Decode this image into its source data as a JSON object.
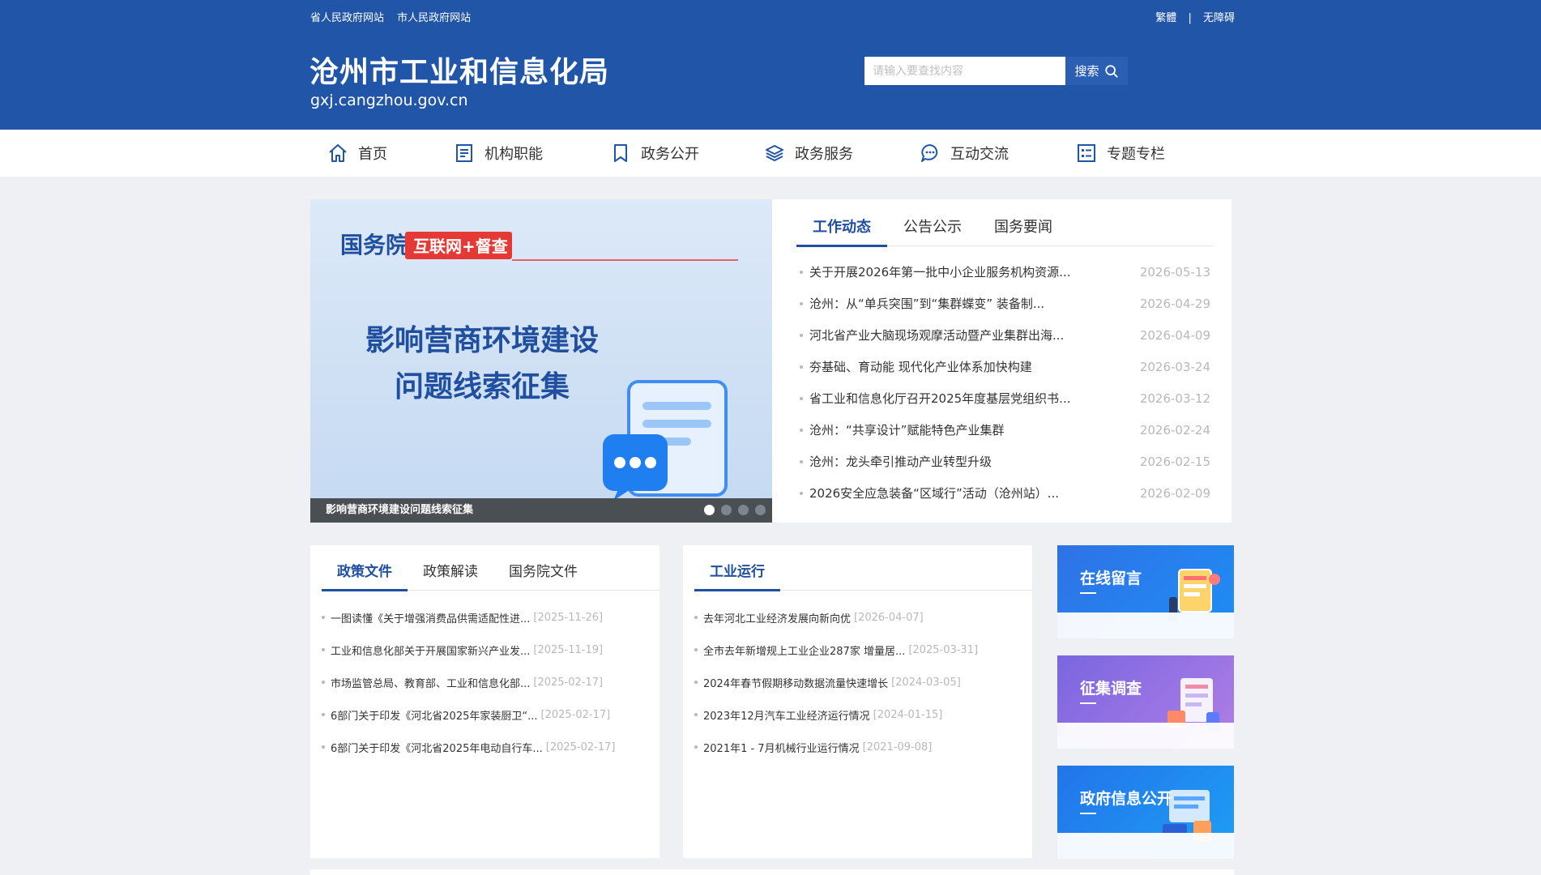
{
  "header": {
    "top_links_left": [
      "省人民政府网站",
      "市人民政府网站"
    ],
    "top_links_right": [
      "繁體",
      "无障碍"
    ],
    "top_links_separator": "|",
    "title": "沧州市工业和信息化局",
    "domain": "gxj.cangzhou.gov.cn",
    "search": {
      "placeholder": "请输入要查找内容",
      "button_label": "搜索",
      "icon": "search-icon"
    },
    "colors": {
      "brand_blue": "#2155a8",
      "accent_blue": "#1f4f9e"
    }
  },
  "nav": [
    {
      "label": "首页",
      "icon": "home-icon"
    },
    {
      "label": "机构职能",
      "icon": "document-list-icon"
    },
    {
      "label": "政务公开",
      "icon": "bookmark-icon"
    },
    {
      "label": "政务服务",
      "icon": "layers-icon"
    },
    {
      "label": "互动交流",
      "icon": "chat-bubble-icon"
    },
    {
      "label": "专题专栏",
      "icon": "checklist-icon"
    }
  ],
  "hero": {
    "badge_left": "国务院",
    "badge_right": "互联网+督查",
    "headline_line1": "影响营商环境建设",
    "headline_line2": "问题线索征集",
    "caption": "影响营商环境建设问题线索征集",
    "slide_count": 4,
    "active_slide": 1
  },
  "news": {
    "tabs": [
      "工作动态",
      "公告公示",
      "国务要闻"
    ],
    "active_tab": 0,
    "items": [
      {
        "title": "关于开展2026年第一批中小企业服务机构资源...",
        "date": "2026-05-13"
      },
      {
        "title": "沧州：从“单兵突围”到“集群蝶变” 装备制...",
        "date": "2026-04-29"
      },
      {
        "title": "河北省产业大脑现场观摩活动暨产业集群出海...",
        "date": "2026-04-09"
      },
      {
        "title": "夯基础、育动能 现代化产业体系加快构建",
        "date": "2026-03-24"
      },
      {
        "title": "省工业和信息化厅召开2025年度基层党组织书...",
        "date": "2026-03-12"
      },
      {
        "title": "沧州：“共享设计”赋能特色产业集群",
        "date": "2026-02-24"
      },
      {
        "title": "沧州：龙头牵引推动产业转型升级",
        "date": "2026-02-15"
      },
      {
        "title": "2026安全应急装备“区域行”活动（沧州站）...",
        "date": "2026-02-09"
      }
    ]
  },
  "policy": {
    "tabs": [
      "政策文件",
      "政策解读",
      "国务院文件"
    ],
    "active_tab": 0,
    "items": [
      {
        "title": "一图读懂《关于增强消费品供需适配性进...",
        "date": "[2025-11-26]"
      },
      {
        "title": "工业和信息化部关于开展国家新兴产业发...",
        "date": "[2025-11-19]"
      },
      {
        "title": "市场监管总局、教育部、工业和信息化部...",
        "date": "[2025-02-17]"
      },
      {
        "title": "6部门关于印发《河北省2025年家装厨卫“...",
        "date": "[2025-02-17]"
      },
      {
        "title": "6部门关于印发《河北省2025年电动自行车...",
        "date": "[2025-02-17]"
      }
    ]
  },
  "industry": {
    "tabs": [
      "工业运行"
    ],
    "active_tab": 0,
    "items": [
      {
        "title": "去年河北工业经济发展向新向优",
        "date": "[2026-04-07]"
      },
      {
        "title": "全市去年新增规上工业企业287家 增量居...",
        "date": "[2025-03-31]"
      },
      {
        "title": "2024年春节假期移动数据流量快速增长",
        "date": "[2024-03-05]"
      },
      {
        "title": "2023年12月汽车工业经济运行情况",
        "date": "[2024-01-15]"
      },
      {
        "title": "2021年1 - 7月机械行业运行情况",
        "date": "[2021-09-08]"
      }
    ]
  },
  "side_banners": [
    {
      "label": "在线留言",
      "icon": "message-board-icon"
    },
    {
      "label": "征集调查",
      "icon": "survey-icon"
    },
    {
      "label": "政府信息公开",
      "icon": "info-disclosure-icon"
    }
  ]
}
